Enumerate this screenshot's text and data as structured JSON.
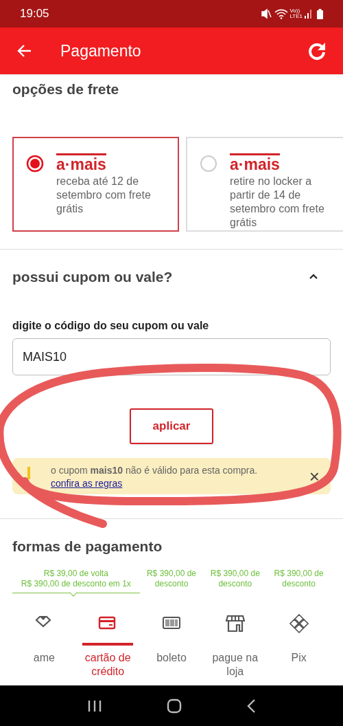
{
  "status_bar": {
    "time": "19:05",
    "network_top": "Vo))",
    "network_bottom": "LTE1"
  },
  "header": {
    "title": "Pagamento"
  },
  "shipping": {
    "title": "opções de frete",
    "options": [
      {
        "brand": "a·mais",
        "text": "receba até 12 de setembro com frete grátis",
        "selected": true
      },
      {
        "brand": "a·mais",
        "text": "retire no locker a partir de 14 de setembro com frete grátis",
        "selected": false
      }
    ]
  },
  "coupon": {
    "title": "possui cupom ou vale?",
    "expanded": true,
    "field_label": "digite o código do seu cupom ou vale",
    "value": "MAIS10",
    "button": "aplicar",
    "alert": {
      "message": "o cupom **mais10** não é válido para esta compra.",
      "link": "confira as regras",
      "close": "×"
    }
  },
  "payment": {
    "title": "formas de pagamento",
    "offers": [
      {
        "lines": [
          "R$ 39,00 de volta",
          "R$ 390,00 de desconto em 1x"
        ],
        "highlighted": true
      },
      {
        "lines": [
          "R$ 390,00 de",
          "desconto"
        ],
        "highlighted": false
      },
      {
        "lines": [
          "R$ 390,00 de",
          "desconto"
        ],
        "highlighted": false
      },
      {
        "lines": [
          "R$ 390,00 de",
          "desconto"
        ],
        "highlighted": false
      }
    ],
    "methods": [
      {
        "kind": "ame",
        "label": "ame",
        "selected": false
      },
      {
        "kind": "card",
        "label": "cartão de crédito",
        "selected": true
      },
      {
        "kind": "boleto",
        "label": "boleto",
        "selected": false
      },
      {
        "kind": "store",
        "label": "pague na loja",
        "selected": false
      },
      {
        "kind": "pix",
        "label": "Pix",
        "selected": false
      }
    ]
  }
}
